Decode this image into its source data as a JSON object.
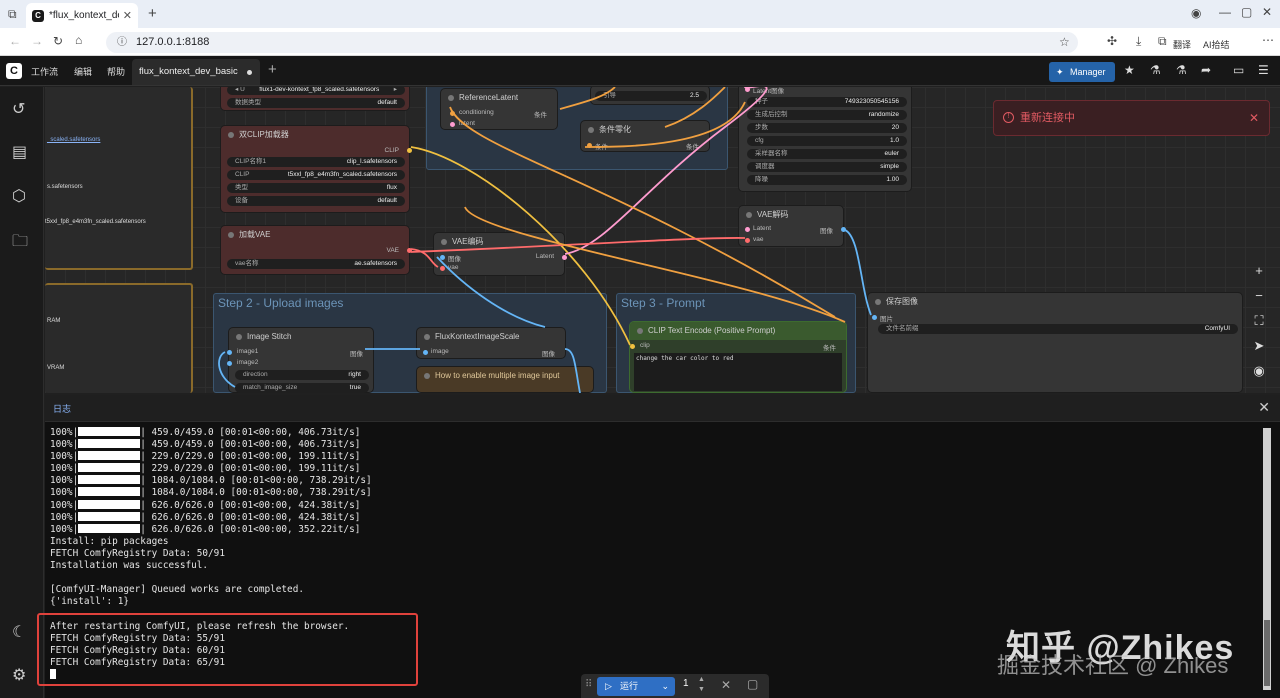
{
  "browser": {
    "tab_title": "*flux_kontext_dev",
    "url": "127.0.0.1:8188",
    "translate_label": "翻译",
    "ai_label": "AI拾结"
  },
  "menu": {
    "items": [
      "工作流",
      "编辑",
      "帮助"
    ],
    "workflow_tab": "flux_kontext_dev_basic",
    "manager_label": "Manager"
  },
  "canvas": {
    "groups": {
      "step2": "Step 2 - Upload images",
      "step3": "Step 3 - Prompt"
    },
    "nodes": {
      "unet": {
        "model_name": "flux1-dev-kontext_fp8_scaled.safetensors",
        "dtype_label": "数据类型",
        "dtype": "default"
      },
      "dualclip": {
        "title": "双CLIP加载器",
        "clip1_label": "CLIP名称1",
        "clip1": "clip_l.safetensors",
        "clip2_label": "CLIP",
        "clip2": "t5xxl_fp8_e4m3fn_scaled.safetensors",
        "type_label": "类型",
        "type": "flux",
        "device_label": "设备",
        "device": "default",
        "out": "CLIP"
      },
      "vae_loader": {
        "title": "加载VAE",
        "vae_label": "vae名称",
        "vae": "ae.safetensors",
        "out": "VAE"
      },
      "ref_latent": {
        "title": "ReferenceLatent",
        "in1": "conditioning",
        "in2": "latent",
        "out": "条件"
      },
      "guidance": {
        "label": "引导",
        "value": "2.5"
      },
      "cond_zero": {
        "title": "条件零化",
        "in": "条件",
        "out": "条件"
      },
      "ksampler": {
        "in": "Latent图像",
        "seed_label": "种子",
        "seed": "749323050545156",
        "ctrl_label": "生成后控制",
        "ctrl": "randomize",
        "steps_label": "步数",
        "steps": "20",
        "cfg_label": "cfg",
        "cfg": "1.0",
        "sampler_label": "采样器名称",
        "sampler": "euler",
        "sched_label": "调度器",
        "sched": "simple",
        "denoise_label": "降噪",
        "denoise": "1.00"
      },
      "vae_decode": {
        "title": "VAE解码",
        "in1": "Latent",
        "in2": "vae",
        "out": "图像"
      },
      "vae_encode": {
        "title": "VAE编码",
        "in1": "图像",
        "in2": "vae",
        "out": "Latent"
      },
      "save_image": {
        "title": "保存图像",
        "in": "图片",
        "prefix_label": "文件名前缀",
        "prefix": "ComfyUI"
      },
      "image_stitch": {
        "title": "Image Stitch",
        "in1": "image1",
        "in2": "image2",
        "out": "图像",
        "dir_label": "direction",
        "dir": "right",
        "match_label": "match_image_size",
        "match": "true"
      },
      "kontext_scale": {
        "title": "FluxKontextImageScale",
        "in": "image",
        "out": "图像"
      },
      "howto": {
        "title": "How to enable multiple image input"
      },
      "clip_text": {
        "title": "CLIP Text Encode (Positive Prompt)",
        "in": "clip",
        "out": "条件",
        "text": "change the car color to red"
      },
      "left_panel": {
        "line1": "_scaled.safetensors",
        "line2": "s.safetensors",
        "line3": "t5xxl_fp8_e4m3fn_scaled.safetensors",
        "line4": "RAM",
        "line5": "VRAM"
      }
    },
    "reconnect": "重新连接中"
  },
  "log": {
    "tab": "日志",
    "lines": [
      {
        "pct": "100%|",
        "rest": "| 459.0/459.0 [00:01<00:00, 406.73it/s]"
      },
      {
        "pct": "100%|",
        "rest": "| 459.0/459.0 [00:01<00:00, 406.73it/s]"
      },
      {
        "pct": "100%|",
        "rest": "| 229.0/229.0 [00:01<00:00, 199.11it/s]"
      },
      {
        "pct": "100%|",
        "rest": "| 229.0/229.0 [00:01<00:00, 199.11it/s]"
      },
      {
        "pct": "100%|",
        "rest": "| 1084.0/1084.0 [00:01<00:00, 738.29it/s]"
      },
      {
        "pct": "100%|",
        "rest": "| 1084.0/1084.0 [00:01<00:00, 738.29it/s]"
      },
      {
        "pct": "100%|",
        "rest": "| 626.0/626.0 [00:01<00:00, 424.38it/s]"
      },
      {
        "pct": "100%|",
        "rest": "| 626.0/626.0 [00:01<00:00, 424.38it/s]"
      },
      {
        "pct": "100%|",
        "rest": "| 626.0/626.0 [00:01<00:00, 352.22it/s]"
      }
    ],
    "text_lines": [
      "Install: pip packages",
      "FETCH ComfyRegistry Data: 50/91",
      "Installation was successful.",
      "",
      "[ComfyUI-Manager] Queued works are completed.",
      "{'install': 1}",
      "",
      "After restarting ComfyUI, please refresh the browser.",
      "FETCH ComfyRegistry Data: 55/91",
      "FETCH ComfyRegistry Data: 60/91",
      "FETCH ComfyRegistry Data: 65/91"
    ]
  },
  "runbar": {
    "run_label": "运行",
    "count": "1"
  },
  "watermark": {
    "line1": "知乎 @Zhikes",
    "line2": "掘金技术社区 @ Zhikes"
  }
}
